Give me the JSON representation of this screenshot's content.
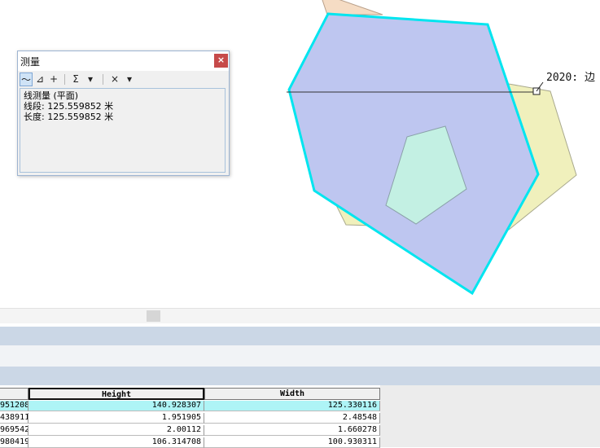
{
  "map": {
    "feature_label": "2020: 边"
  },
  "measure_window": {
    "title": "测量",
    "close_icon": "×",
    "tools": [
      {
        "name": "measure-line-tool",
        "glyph": "〜"
      },
      {
        "name": "measure-area-tool",
        "glyph": "⊿"
      },
      {
        "name": "measure-feature-tool",
        "glyph": "+"
      },
      {
        "name": "sum-tool",
        "glyph": "Σ"
      },
      {
        "name": "sum-dropdown",
        "glyph": "▾"
      },
      {
        "name": "clear-tool",
        "glyph": "×"
      },
      {
        "name": "clear-dropdown",
        "glyph": "▾"
      }
    ],
    "result_lines": [
      "线测量 (平面)",
      "线段: 125.559852 米",
      "长度: 125.559852 米"
    ]
  },
  "table": {
    "columns": [
      "",
      "Height",
      "Width"
    ],
    "rows": [
      [
        "951208",
        "140.928307",
        "125.330116"
      ],
      [
        "438911",
        "1.951905",
        "2.48548"
      ],
      [
        "969542",
        "2.00112",
        "1.660278"
      ],
      [
        "980419",
        "106.314708",
        "100.930311"
      ]
    ],
    "selected_row": 0
  },
  "colors": {
    "selection_outline": "#00e5ef",
    "selected_fill": "#bec6f0",
    "yellow_fill": "#f0f0bc",
    "peach_fill": "#f5dcc4",
    "hole_fill": "#c3f0e3",
    "selected_row": "#aef4f6"
  }
}
